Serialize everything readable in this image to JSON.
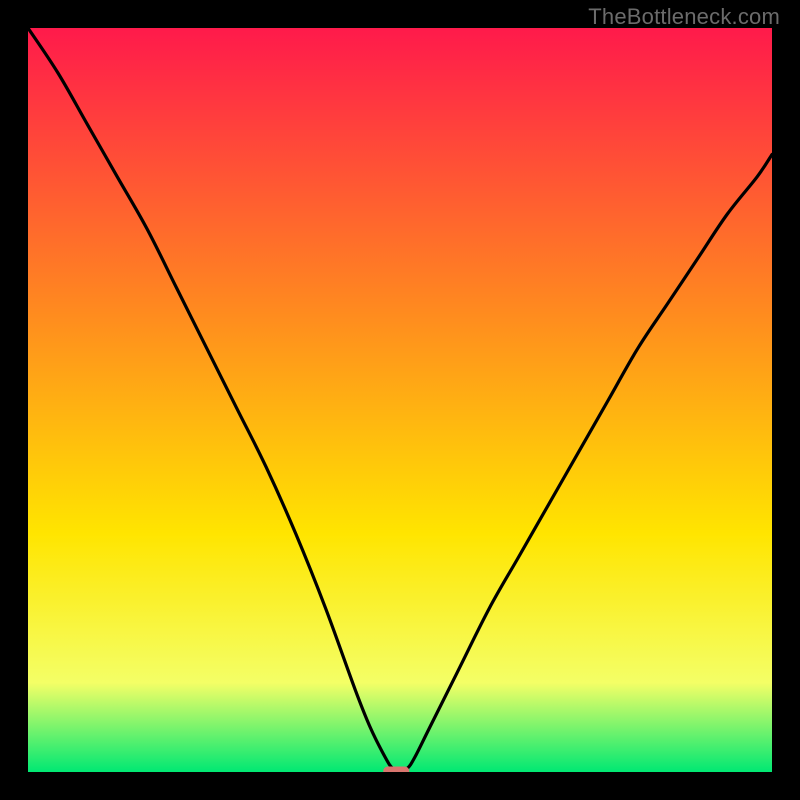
{
  "watermark": "TheBottleneck.com",
  "chart_data": {
    "type": "line",
    "title": "",
    "xlabel": "",
    "ylabel": "",
    "xlim": [
      0,
      100
    ],
    "ylim": [
      0,
      100
    ],
    "grid": false,
    "legend": false,
    "background_gradient": {
      "top_color": "#ff1a4b",
      "mid_upper_color": "#ff8a1f",
      "mid_color": "#ffe500",
      "lower_mid_color": "#f4ff66",
      "bottom_color": "#00e873"
    },
    "series": [
      {
        "name": "bottleneck-curve",
        "color": "#000000",
        "x": [
          0,
          4,
          8,
          12,
          16,
          20,
          24,
          28,
          32,
          36,
          40,
          44,
          46,
          48,
          49,
          50,
          51,
          52,
          54,
          58,
          62,
          66,
          70,
          74,
          78,
          82,
          86,
          90,
          94,
          98,
          100
        ],
        "y": [
          100,
          94,
          87,
          80,
          73,
          65,
          57,
          49,
          41,
          32,
          22,
          11,
          6,
          2,
          0.5,
          0,
          0.5,
          2,
          6,
          14,
          22,
          29,
          36,
          43,
          50,
          57,
          63,
          69,
          75,
          80,
          83
        ]
      }
    ],
    "marker": {
      "name": "optimal-point",
      "shape": "capsule",
      "color": "#d9756e",
      "x": 49.5,
      "y": 0,
      "width": 3.5,
      "height": 1.2
    }
  }
}
